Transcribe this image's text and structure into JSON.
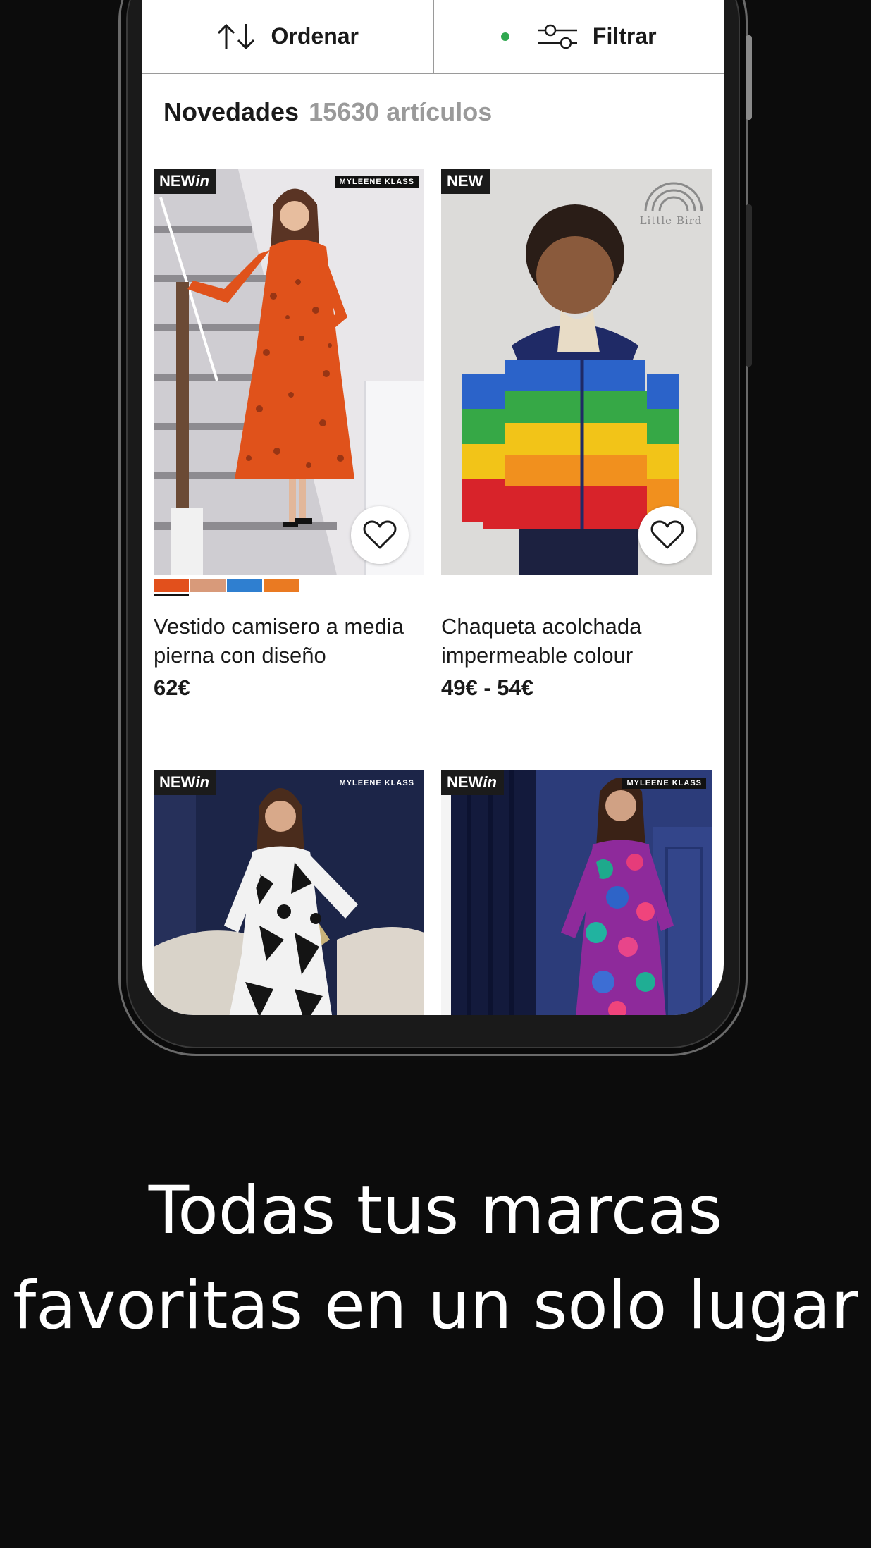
{
  "toolbar": {
    "sort_label": "Ordenar",
    "filter_label": "Filtrar",
    "filter_active_color": "#2fa84f"
  },
  "header": {
    "title": "Novedades",
    "count": "15630 artículos"
  },
  "products": [
    {
      "badge_new": "NEW",
      "badge_in": "in",
      "brand": "MYLEENE KLASS",
      "name": "Vestido camisero a media pierna con diseño",
      "price": "62€",
      "swatches": [
        "#e2501c",
        "#d89a7a",
        "#2f7fd0",
        "#ea7a22"
      ]
    },
    {
      "badge_new": "NEW",
      "badge_in": "",
      "brand": "Little Bird",
      "name": "Chaqueta acolchada impermeable colour",
      "price": "49€ - 54€"
    },
    {
      "badge_new": "NEW",
      "badge_in": "in",
      "brand": "MYLEENE KLASS"
    },
    {
      "badge_new": "NEW",
      "badge_in": "in",
      "brand": "MYLEENE KLASS"
    }
  ],
  "tagline": "Todas tus marcas favoritas en un solo lugar"
}
